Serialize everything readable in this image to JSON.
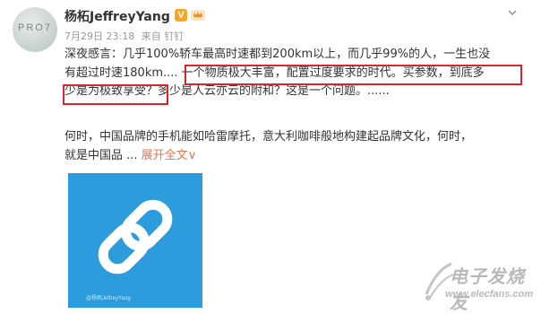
{
  "post": {
    "avatar_text": "PRO7",
    "username": "杨柘JeffreyYang",
    "verified_badge": "V",
    "date": "7月29日 23:18",
    "source": "来自 钉钉",
    "paragraph1": {
      "line1": "深夜感言：几乎100%轿车最高时速都到200km以上，而几乎99%的人，一生也没",
      "line2_pre": "有超过时速180km.... ",
      "line2_hl": "一个物质极大丰富，配置过度要求的时代。买参数，到底多",
      "line3_hl": "少是为极致享受？",
      "line3_post": "多少是人云亦云的附和？这是一个问题。......"
    },
    "paragraph2": {
      "line1": "何时，中国品牌的手机能如哈雷摩托，意大利咖啡般地构建起品牌文化，何时，",
      "line2": "就是中国品 ...",
      "expand": "展开全文",
      "expand_arrow": "∨"
    },
    "thumbnail": {
      "icon": "link-icon",
      "bg_color": "#2c9cdc",
      "caption": "@杨柘JeffreyYang"
    },
    "highlight_color": "#d9262c",
    "link_color": "#eb7350"
  },
  "watermark": {
    "text_cn": "电子发烧友",
    "url": "www.elecfans.com"
  }
}
